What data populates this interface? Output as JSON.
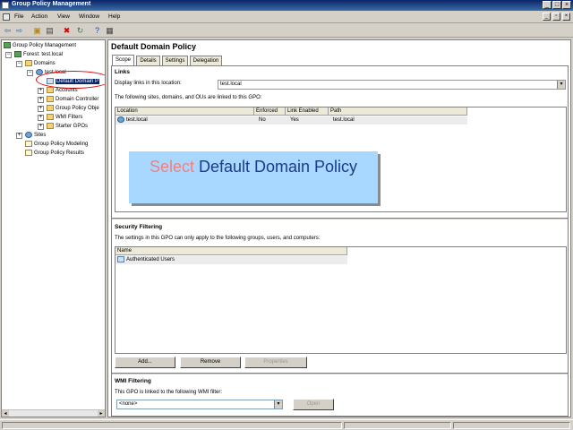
{
  "window": {
    "title": "Group Policy Management"
  },
  "menu": [
    "File",
    "Action",
    "View",
    "Window",
    "Help"
  ],
  "toolbar_icons": [
    "back-arrow-icon",
    "forward-arrow-icon",
    "up-folder-icon",
    "show-hide-icon",
    "help-icon",
    "delete-icon",
    "refresh-icon",
    "properties-icon",
    "help-book-icon"
  ],
  "tree": {
    "root": "Group Policy Management",
    "forest": "Forest: test.local",
    "domains": "Domains",
    "domain": "test.local",
    "selected": "Default Domain P",
    "children": [
      "Accounts",
      "Domain Controller",
      "Group Policy Obje",
      "WMI Filters",
      "Starter GPOs"
    ],
    "sites": "Sites",
    "modeling": "Group Policy Modeling",
    "results": "Group Policy Results"
  },
  "policy": {
    "title": "Default Domain Policy",
    "tabs": [
      "Scope",
      "Details",
      "Settings",
      "Delegation"
    ],
    "active_tab": "Scope"
  },
  "links": {
    "title": "Links",
    "display_label": "Display links in this location:",
    "location_value": "test.local",
    "description": "The following sites, domains, and OUs are linked to this GPO:",
    "columns": [
      "Location",
      "Enforced",
      "Link Enabled",
      "Path"
    ],
    "rows": [
      {
        "location": "test.local",
        "enforced": "No",
        "link_enabled": "Yes",
        "path": "test.local"
      }
    ]
  },
  "security": {
    "title": "Security Filtering",
    "description": "The settings in this GPO can only apply to the following groups, users, and computers:",
    "columns": [
      "Name"
    ],
    "rows": [
      "Authenticated Users"
    ],
    "buttons": {
      "add": "Add...",
      "remove": "Remove",
      "properties": "Properties"
    }
  },
  "wmi": {
    "title": "WMI Filtering",
    "description": "This GPO is linked to the following WMI filter:",
    "value": "<none>",
    "open_label": "Open"
  },
  "callout": {
    "highlight": "Select",
    "rest": "Default Domain Policy"
  },
  "colors": {
    "callout_bg": "#a8d8ff",
    "callout_select": "#f08080",
    "callout_text": "#1a3c8c",
    "annotation": "#e00000"
  }
}
